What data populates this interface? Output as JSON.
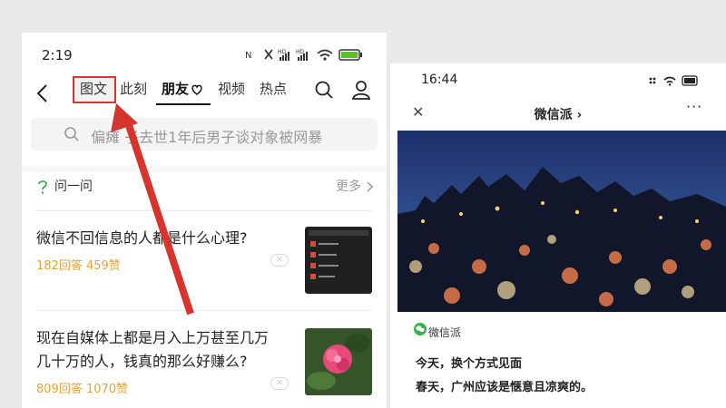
{
  "left_phone": {
    "status_time": "2:19",
    "nav": {
      "tabs": [
        "图文",
        "此刻",
        "朋友",
        "视频",
        "热点"
      ],
      "active_tab": "朋友",
      "highlighted_tab": "图文"
    },
    "search_placeholder": "偏瘫   子去世1年后男子谈对象被网暴",
    "qa_section": {
      "title": "问一问",
      "more_label": "更多"
    },
    "questions": [
      {
        "title_line1": "微信不回信息的人都是什么心理?",
        "stats": "182回答 459赞"
      },
      {
        "title_line1": "现在自媒体上都是月入上万甚至几万",
        "title_line2": "几十万的人，钱真的那么好赚么?",
        "stats": "809回答 1070赞"
      }
    ],
    "colors": {
      "accent_stats": "#e8a23a",
      "arrow": "#d6342c"
    }
  },
  "right_phone": {
    "status_time": "16:44",
    "header": {
      "title": "微信派",
      "chevron": "›"
    },
    "brand": "微信派",
    "subtitle": "今天，换个方式见面",
    "body_text": "春天，广州应该是惬意且凉爽的。"
  }
}
